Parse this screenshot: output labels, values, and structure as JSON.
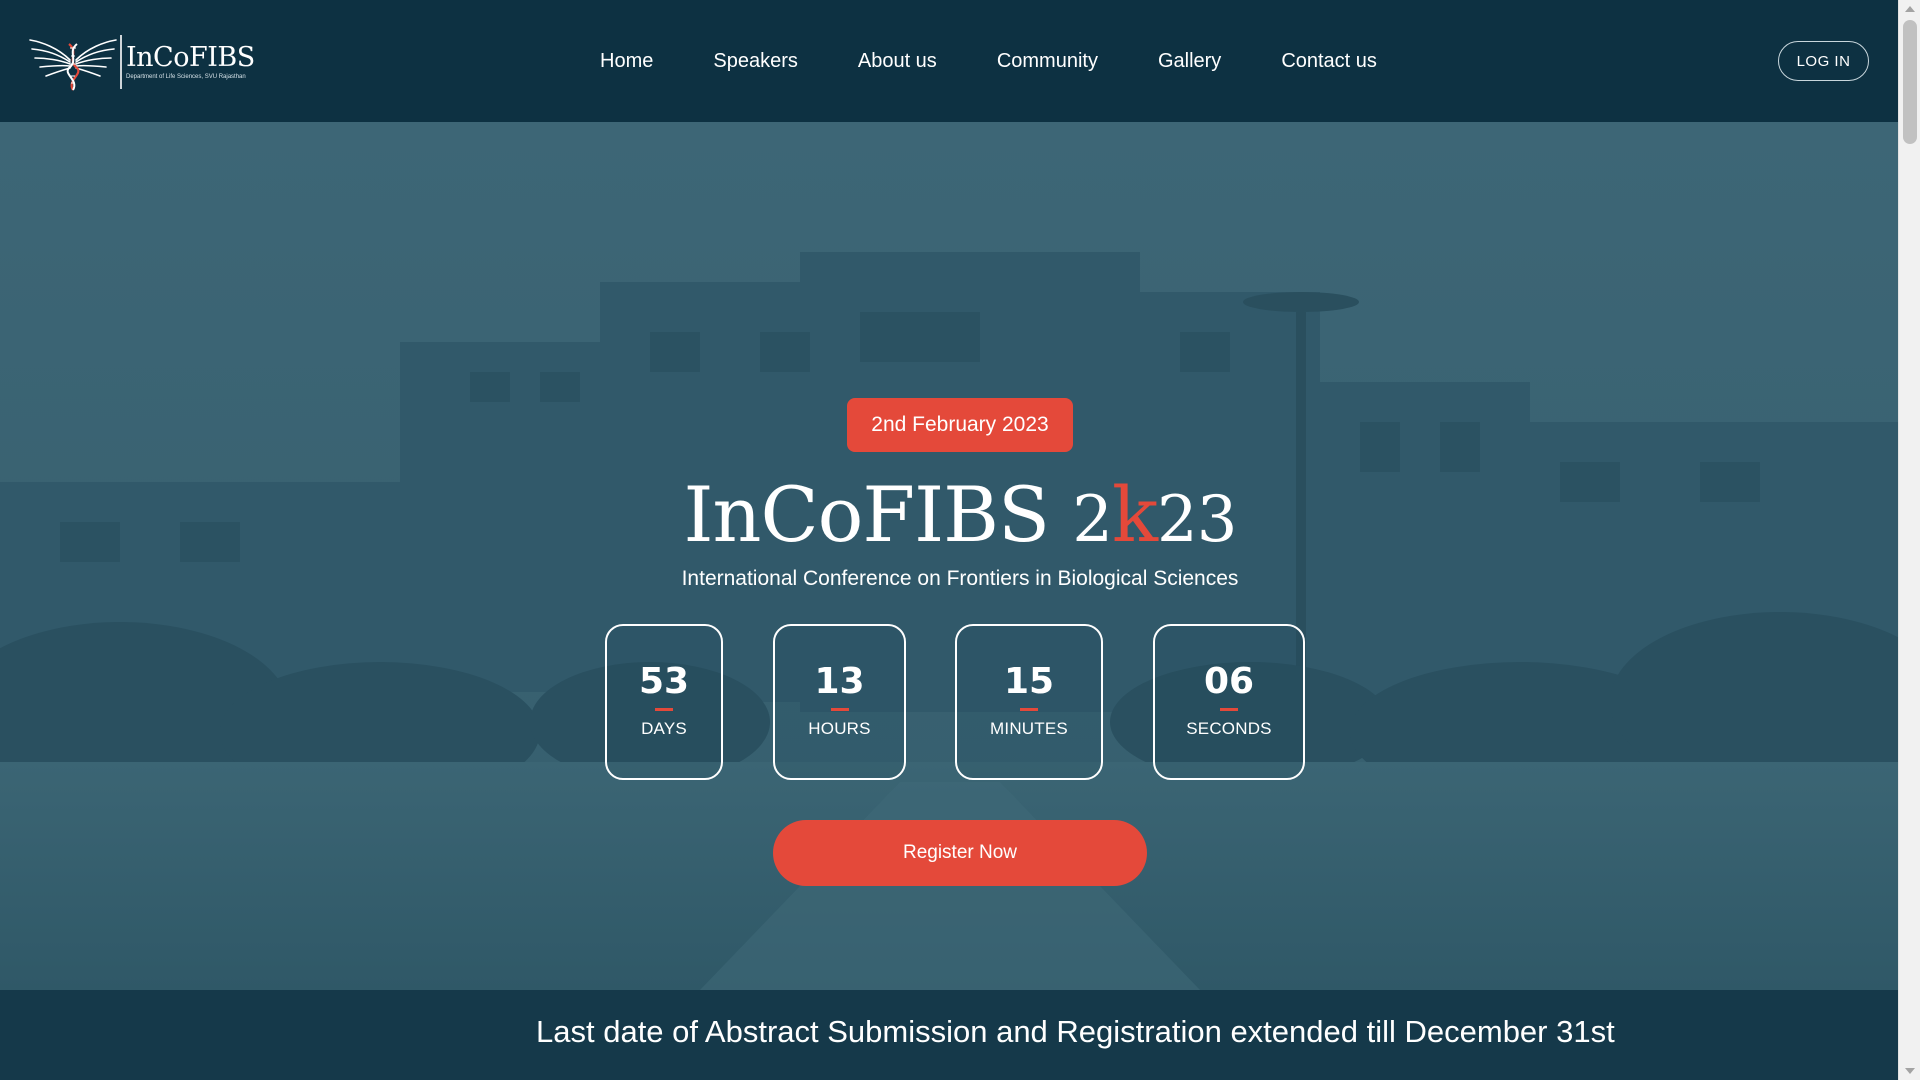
{
  "header": {
    "logo_text": "InCoFIBS",
    "logo_subtext": "Department of Life Sciences, SVU Rajasthan",
    "nav": [
      {
        "label": "Home"
      },
      {
        "label": "Speakers"
      },
      {
        "label": "About us"
      },
      {
        "label": "Community"
      },
      {
        "label": "Gallery"
      },
      {
        "label": "Contact us"
      }
    ],
    "login_label": "LOG IN"
  },
  "hero": {
    "date_badge": "2nd February 2023",
    "title_main": "InCoFIBS",
    "title_year_prefix": "2",
    "title_year_accent": "k",
    "title_year_suffix": "23",
    "subtitle": "International Conference on Frontiers in Biological Sciences",
    "countdown": [
      {
        "value": "53",
        "label": "DAYS"
      },
      {
        "value": "13",
        "label": "HOURS"
      },
      {
        "value": "15",
        "label": "MINUTES"
      },
      {
        "value": "06",
        "label": "SECONDS"
      }
    ],
    "register_label": "Register Now"
  },
  "announcement": "Last date of Abstract Submission and Registration extended till December 31st",
  "colors": {
    "header_bg": "#0d3142",
    "accent": "#e4493a",
    "hero_overlay": "#3a6373"
  }
}
